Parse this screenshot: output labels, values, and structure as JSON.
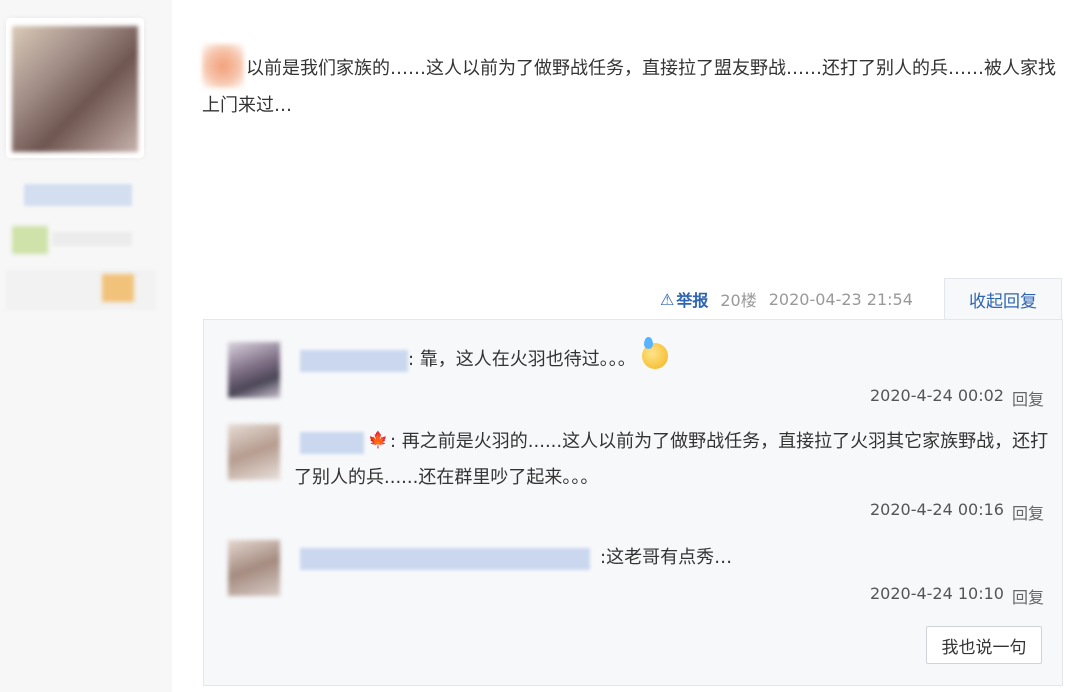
{
  "post": {
    "body_text": "以前是我们家族的……这人以前为了做野战任务，直接拉了盟友野战……还打了别人的兵……被人家找上门来过…",
    "report_label": "举报",
    "floor": "20楼",
    "timestamp": "2020-04-23 21:54",
    "collapse_label": "收起回复"
  },
  "replies": [
    {
      "text": ": 靠，这人在火羽也待过。。。",
      "time": "2020-4-24 00:02",
      "reply_label": "回复"
    },
    {
      "text": ": 再之前是火羽的......这人以前为了做野战任务，直接拉了火羽其它家族野战，还打了别人的兵......还在群里吵了起来。。。",
      "time": "2020-4-24 00:16",
      "reply_label": "回复"
    },
    {
      "text": ":这老哥有点秀…",
      "time": "2020-4-24 10:10",
      "reply_label": "回复"
    }
  ],
  "say_button_label": "我也说一句",
  "colors": {
    "link_blue": "#2d64b3",
    "reply_bg": "#f7f8fa",
    "border": "#e3e6ec"
  },
  "icons": {
    "report": "warning-triangle-icon",
    "emoji": "sweat-face-icon",
    "leaf": "maple-leaf-icon"
  }
}
